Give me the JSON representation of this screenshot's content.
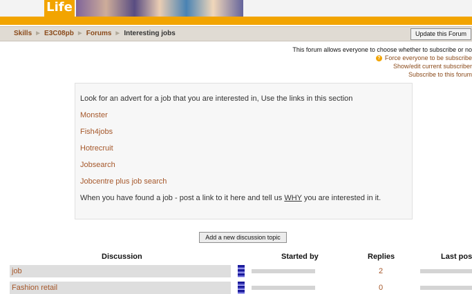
{
  "banner": {
    "logo_text": "Life"
  },
  "breadcrumb": [
    {
      "label": "Skills",
      "link": true
    },
    {
      "label": "E3C08pb",
      "link": true
    },
    {
      "label": "Forums",
      "link": true
    },
    {
      "label": "Interesting jobs",
      "link": false
    }
  ],
  "toolbar": {
    "update_label": "Update this Forum"
  },
  "subscription": {
    "info": "This forum allows everyone to choose whether to subscribe or no",
    "force": "Force everyone to be subscribe",
    "show_edit": "Show/edit current subscriber",
    "subscribe": "Subscribe to this forum"
  },
  "intro": {
    "text": "Look for an advert for a job that you are interested in, Use the links in this section",
    "links": [
      "Monster",
      "Fish4jobs",
      "Hotrecruit",
      "Jobsearch",
      "Jobcentre plus job search"
    ],
    "footer_before": "When you have found a job - post a link to it here and tell us ",
    "footer_emph": "WHY",
    "footer_after": " you are interested in it."
  },
  "add_topic_label": "Add a new discussion topic",
  "table": {
    "headers": {
      "discussion": "Discussion",
      "started_by": "Started by",
      "replies": "Replies",
      "last_post": "Last pos"
    },
    "rows": [
      {
        "discussion": "job",
        "replies": "2"
      },
      {
        "discussion": "Fashion retail",
        "replies": "0"
      }
    ]
  },
  "colors": {
    "accent_orange": "#f2a400",
    "link_brown": "#a5572a",
    "navbar_bg": "#e0dbd3"
  }
}
